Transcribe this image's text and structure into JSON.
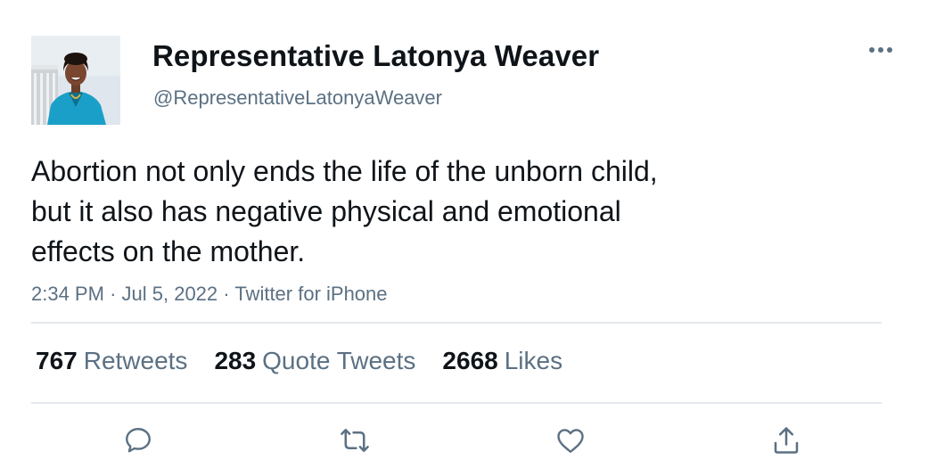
{
  "user": {
    "display_name": "Representative Latonya Weaver",
    "handle": "@RepresentativeLatonyaWeaver",
    "avatar_icon": "profile-photo"
  },
  "tweet": {
    "text_lines": [
      "Abortion not only ends the life of the unborn child,",
      "but it also has negative physical and emotional",
      "effects on the mother."
    ],
    "time": "2:34 PM",
    "date": "Jul 5, 2022",
    "source": "Twitter for iPhone",
    "separator": "·"
  },
  "stats": {
    "retweets": {
      "count": "767",
      "label": "Retweets"
    },
    "quote_tweets": {
      "count": "283",
      "label": "Quote Tweets"
    },
    "likes": {
      "count": "2668",
      "label": "Likes"
    }
  },
  "actions": {
    "reply_icon": "speech-bubble",
    "retweet_icon": "retweet-arrows",
    "like_icon": "heart",
    "share_icon": "upload-arrow",
    "more_icon": "three-dots"
  },
  "colors": {
    "text_primary": "#0f1419",
    "text_secondary": "#5b7083",
    "divider": "#e4e8ec",
    "icon": "#5b7083"
  }
}
